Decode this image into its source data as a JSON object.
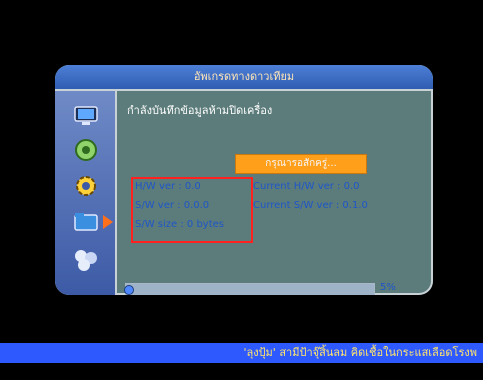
{
  "window": {
    "title": "อัพเกรดทางดาวเทียม"
  },
  "sidebar": {
    "items": [
      {
        "icon": "monitor-icon"
      },
      {
        "icon": "satellite-dish-icon"
      },
      {
        "icon": "gear-icon"
      },
      {
        "icon": "upgrade-folder-icon",
        "selected": true
      },
      {
        "icon": "network-icon"
      }
    ]
  },
  "content": {
    "heading": "กำลังบันทึกข้อมูลห้ามปิดเครื่อง",
    "wait_label": "กรุณารอสักครู่...",
    "hw_ver": "H/W ver : 0.0",
    "sw_ver": "S/W ver : 0.0.0",
    "sw_size": "S/W size : 0 bytes",
    "current_hw_ver": "Current H/W ver : 0.0",
    "current_sw_ver": "Current S/W ver : 0.1.0",
    "progress_percent_label": "5%",
    "progress_value": 0.05
  },
  "ticker": {
    "text": "'ลุงปุ้ม' สามีป้าจุ๊สิ้นลม คิดเชื้อในกระแสเลือดโรงพ"
  },
  "colors": {
    "background": "#000000",
    "window": "#5b7c7a",
    "titlebar": "#3b6fd0",
    "sidebar": "#4f6fb8",
    "info_text": "#1f56c9",
    "wait_button": "#ff9f1a",
    "highlight": "#ff2020",
    "ticker_bg": "#2e59ff",
    "ticker_text": "#ffe56b"
  }
}
